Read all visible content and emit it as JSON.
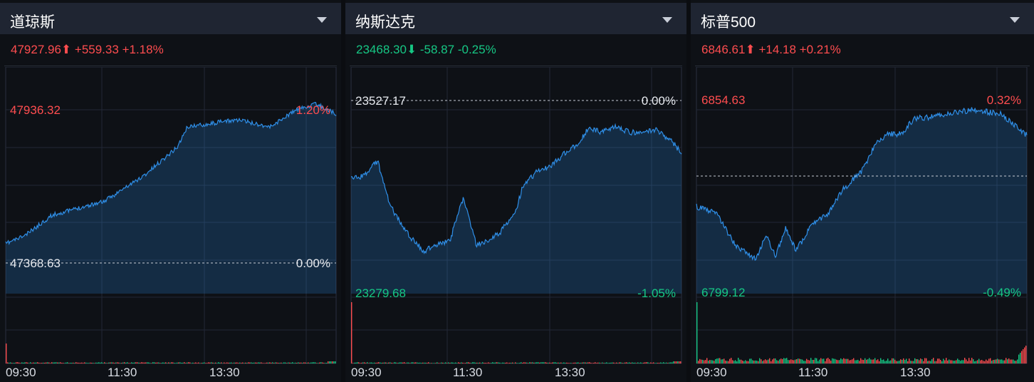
{
  "colors": {
    "up": "#ff4d4f",
    "down": "#16c784",
    "line": "#2f8fe8",
    "grid": "#2a3040",
    "header_bg": "#1f2532"
  },
  "panels": [
    {
      "name": "道琼斯",
      "dropdown_icon": "triangle-down-icon",
      "price": "47927.96",
      "direction": "up",
      "arrow": "⬆",
      "change": "+559.33",
      "change_pct": "+1.18%",
      "y_high": "47936.32",
      "pct_high": "1.20%",
      "y_ref": "47368.63",
      "pct_ref": "0.00%",
      "x_ticks": [
        "09:30",
        "11:30",
        "13:30"
      ]
    },
    {
      "name": "纳斯达克",
      "dropdown_icon": "triangle-down-icon",
      "price": "23468.30",
      "direction": "down",
      "arrow": "⬇",
      "change": "-58.87",
      "change_pct": "-0.25%",
      "y_ref": "23527.17",
      "pct_ref": "0.00%",
      "y_low": "23279.68",
      "pct_low": "-1.05%",
      "x_ticks": [
        "09:30",
        "11:30",
        "13:30"
      ]
    },
    {
      "name": "标普500",
      "dropdown_icon": "triangle-down-icon",
      "price": "6846.61",
      "direction": "up",
      "arrow": "⬆",
      "change": "+14.18",
      "change_pct": "+0.21%",
      "y_high": "6854.63",
      "pct_high": "0.32%",
      "y_low": "6799.12",
      "pct_low": "-0.49%",
      "x_ticks": [
        "09:30",
        "11:30",
        "13:30"
      ]
    }
  ]
}
